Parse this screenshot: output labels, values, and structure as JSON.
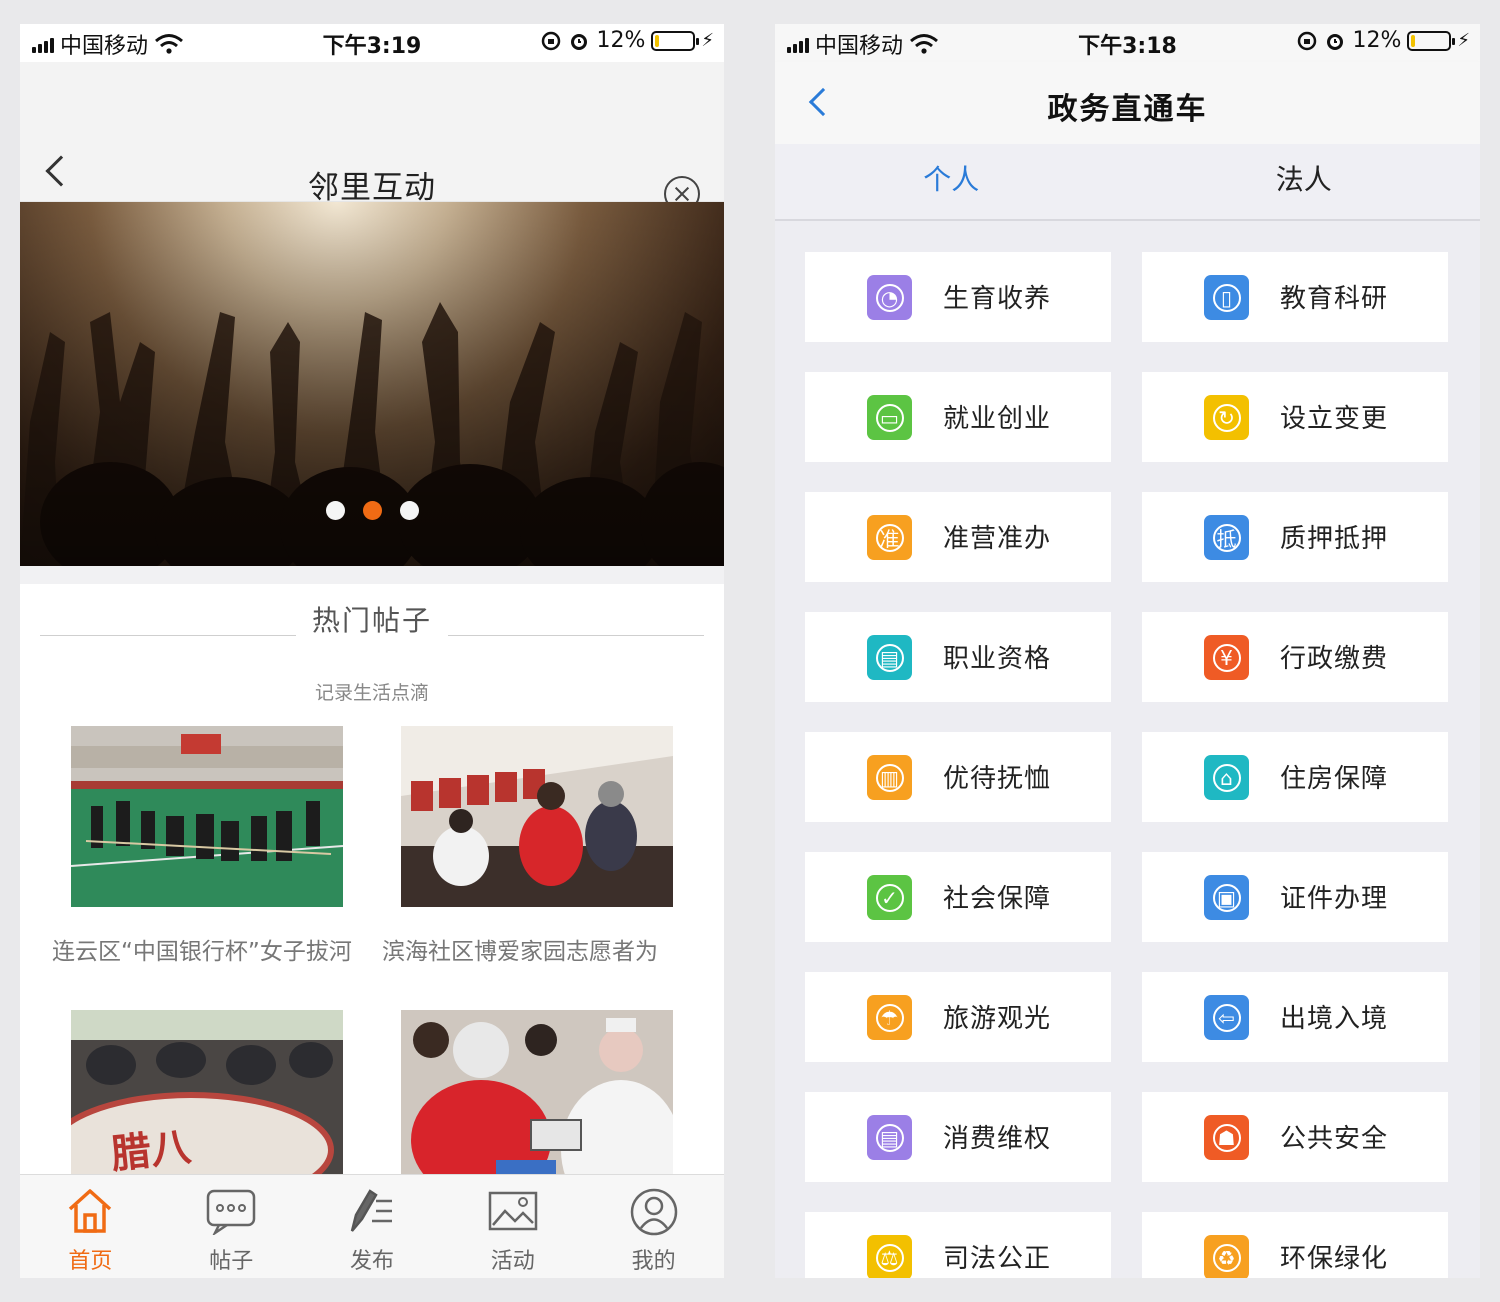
{
  "status_left": {
    "carrier": "中国移动",
    "time": "下午3:19",
    "battery": "12%"
  },
  "status_right": {
    "carrier": "中国移动",
    "time": "下午3:18",
    "battery": "12%"
  },
  "battery_level": 0.12,
  "left": {
    "title": "邻里互动",
    "carousel": {
      "count": 3,
      "active_index": 1
    },
    "section": {
      "title": "热门帖子",
      "subtitle": "记录生活点滴"
    },
    "posts": [
      {
        "title": "连云区“中国银行杯”女子拔河"
      },
      {
        "title": "滨海社区博爱家园志愿者为"
      },
      {
        "title": ""
      },
      {
        "title": ""
      }
    ],
    "tabs": [
      {
        "label": "首页",
        "icon": "home-icon"
      },
      {
        "label": "帖子",
        "icon": "chat-bubble-icon"
      },
      {
        "label": "发布",
        "icon": "pen-icon"
      },
      {
        "label": "活动",
        "icon": "picture-icon"
      },
      {
        "label": "我的",
        "icon": "user-icon"
      }
    ],
    "cake_text": "腊八"
  },
  "right": {
    "title": "政务直通车",
    "segments": [
      "个人",
      "法人"
    ],
    "active_segment": 0,
    "services": [
      {
        "label": "生育收养",
        "color": "#9b7fe6",
        "icon": "birth-icon",
        "glyph": "◔"
      },
      {
        "label": "教育科研",
        "color": "#3d8be3",
        "icon": "book-icon",
        "glyph": "▯"
      },
      {
        "label": "就业创业",
        "color": "#5cc443",
        "icon": "briefcase-icon",
        "glyph": "▭"
      },
      {
        "label": "设立变更",
        "color": "#f3c000",
        "icon": "refresh-icon",
        "glyph": "↻"
      },
      {
        "label": "准营准办",
        "color": "#f7a020",
        "icon": "permit-icon",
        "glyph": "准"
      },
      {
        "label": "质押抵押",
        "color": "#3d8be3",
        "icon": "mortgage-icon",
        "glyph": "抵"
      },
      {
        "label": "职业资格",
        "color": "#1fb8c3",
        "icon": "certificate-icon",
        "glyph": "▤"
      },
      {
        "label": "行政缴费",
        "color": "#ef5b25",
        "icon": "payment-icon",
        "glyph": "¥"
      },
      {
        "label": "优待抚恤",
        "color": "#f7a020",
        "icon": "gift-icon",
        "glyph": "▥"
      },
      {
        "label": "住房保障",
        "color": "#1fb8c3",
        "icon": "house-icon",
        "glyph": "⌂"
      },
      {
        "label": "社会保障",
        "color": "#5cc443",
        "icon": "shield-icon",
        "glyph": "✓"
      },
      {
        "label": "证件办理",
        "color": "#3d8be3",
        "icon": "id-card-icon",
        "glyph": "▣"
      },
      {
        "label": "旅游观光",
        "color": "#f7a020",
        "icon": "travel-icon",
        "glyph": "☂"
      },
      {
        "label": "出境入境",
        "color": "#3d8be3",
        "icon": "exit-entry-icon",
        "glyph": "⇦"
      },
      {
        "label": "消费维权",
        "color": "#9b7fe6",
        "icon": "consumer-rights-icon",
        "glyph": "▤"
      },
      {
        "label": "公共安全",
        "color": "#ef5b25",
        "icon": "public-safety-icon",
        "glyph": "☗"
      },
      {
        "label": "司法公正",
        "color": "#f3c000",
        "icon": "justice-scale-icon",
        "glyph": "⚖"
      },
      {
        "label": "环保绿化",
        "color": "#f7a020",
        "icon": "recycle-icon",
        "glyph": "♻"
      }
    ]
  }
}
